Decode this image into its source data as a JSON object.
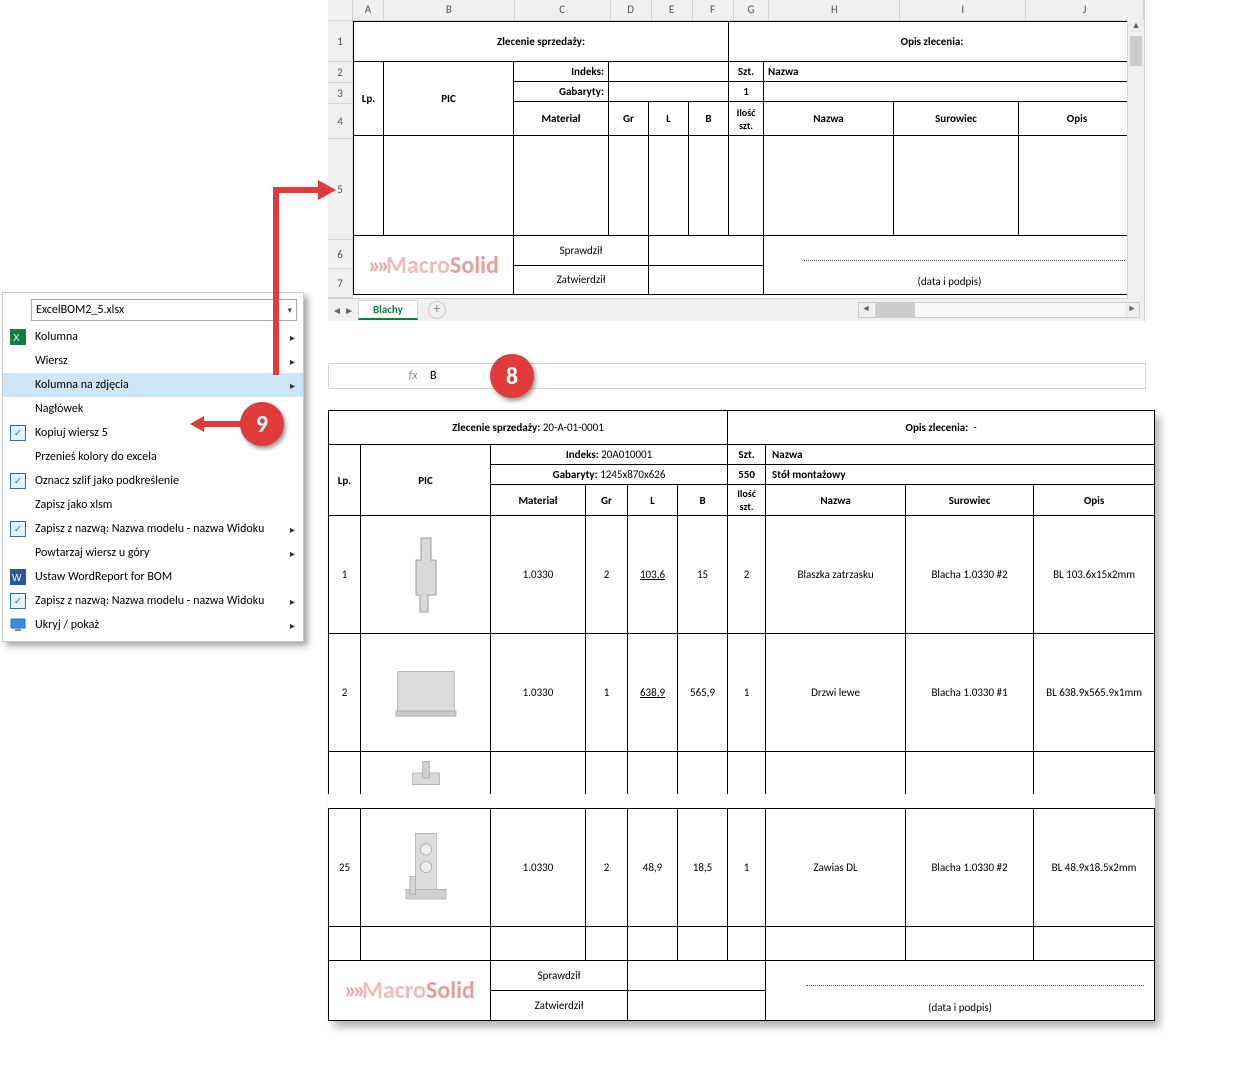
{
  "columns": [
    "A",
    "B",
    "C",
    "D",
    "E",
    "F",
    "G",
    "H",
    "I",
    "J"
  ],
  "row_numbers_top": [
    "1",
    "2",
    "3",
    "4",
    "5",
    "6",
    "7"
  ],
  "top_template": {
    "zlecenie_label": "Zlecenie sprzedaży:",
    "opis_zlecenia_label": "Opis zlecenia:",
    "indeks_label": "Indeks:",
    "gabaryty_label": "Gabaryty:",
    "lp": "Lp.",
    "pic": "PIC",
    "material": "Materiał",
    "gr": "Gr",
    "l": "L",
    "b": "B",
    "szt": "Szt.",
    "one": "1",
    "ilosc": "Ilość szt.",
    "nazwa": "Nazwa",
    "surowiec": "Surowiec",
    "opis": "Opis",
    "sprawdzil": "Sprawdził",
    "zatwierdzil": "Zatwierdził",
    "sig": "(data i podpis)"
  },
  "sheet_tab": "Blachy",
  "watermark": {
    "chev": "»»",
    "t1": "Macro",
    "t2": "Solid"
  },
  "formula_bar": {
    "name": "",
    "value": "B"
  },
  "ctx": {
    "combo": "ExcelBOM2_5.xlsx",
    "items": [
      {
        "icon": "xls",
        "check": false,
        "label": "Kolumna",
        "sub": true
      },
      {
        "icon": "",
        "check": false,
        "label": "Wiersz",
        "sub": true
      },
      {
        "icon": "",
        "check": false,
        "label": "Kolumna na zdjęcia",
        "sub": true,
        "hover": true
      },
      {
        "icon": "",
        "check": false,
        "label": "Nagłówek",
        "sub": false
      },
      {
        "icon": "",
        "check": true,
        "label": "Kopiuj wiersz 5",
        "sub": false
      },
      {
        "icon": "",
        "check": false,
        "label": "Przenieś kolory do excela",
        "sub": false
      },
      {
        "icon": "",
        "check": true,
        "label": "Oznacz szlif jako podkreślenie",
        "sub": false
      },
      {
        "icon": "",
        "check": false,
        "label": "Zapisz jako xlsm",
        "sub": false
      },
      {
        "icon": "",
        "check": true,
        "label": "Zapisz z nazwą: Nazwa modelu - nazwa Widoku",
        "sub": true
      },
      {
        "icon": "",
        "check": false,
        "label": "Powtarzaj wiersz u góry",
        "sub": true
      },
      {
        "icon": "word",
        "check": false,
        "label": "Ustaw WordReport for BOM",
        "sub": false
      },
      {
        "icon": "",
        "check": true,
        "label": "Zapisz z nazwą: Nazwa modelu - nazwa Widoku",
        "sub": true
      },
      {
        "icon": "mon",
        "check": false,
        "label": "Ukryj / pokaż",
        "sub": true
      }
    ]
  },
  "bot": {
    "zlecenie_label": "Zlecenie sprzedaży:",
    "zlecenie_val": "20-A-01-0001",
    "opis_zlecenia_label": "Opis zlecenia:",
    "opis_zlecenia_val": "-",
    "indeks_label": "Indeks:",
    "indeks_val": "20A010001",
    "gabaryty_label": "Gabaryty:",
    "gabaryty_val": "1245x870x626",
    "szt": "Szt.",
    "szt_val": "550",
    "nazwa_header": "Nazwa",
    "nazwa_val": "Stół montażowy",
    "lp": "Lp.",
    "pic": "PIC",
    "material": "Materiał",
    "gr": "Gr",
    "l": "L",
    "b": "B",
    "ilosc": "Ilość szt.",
    "nazwa": "Nazwa",
    "surowiec": "Surowiec",
    "opis": "Opis",
    "rows": [
      {
        "lp": "1",
        "mat": "1.0330",
        "gr": "2",
        "l": "103,6",
        "b": "15",
        "il": "2",
        "naz": "Blaszka zatrzasku",
        "sur": "Blacha 1.0330 #2",
        "op": "BL 103.6x15x2mm"
      },
      {
        "lp": "2",
        "mat": "1.0330",
        "gr": "1",
        "l": "638,9",
        "b": "565,9",
        "il": "1",
        "naz": "Drzwi lewe",
        "sur": "Blacha 1.0330 #1",
        "op": "BL 638.9x565.9x1mm"
      },
      {
        "lp": "25",
        "mat": "1.0330",
        "gr": "2",
        "l": "48,9",
        "b": "18,5",
        "il": "1",
        "naz": "Zawias DL",
        "sur": "Blacha 1.0330 #2",
        "op": "BL 48.9x18.5x2mm"
      }
    ],
    "sprawdzil": "Sprawdził",
    "zatwierdzil": "Zatwierdził",
    "sig": "(data i podpis)"
  },
  "callouts": {
    "c8": "8",
    "c9": "9"
  }
}
